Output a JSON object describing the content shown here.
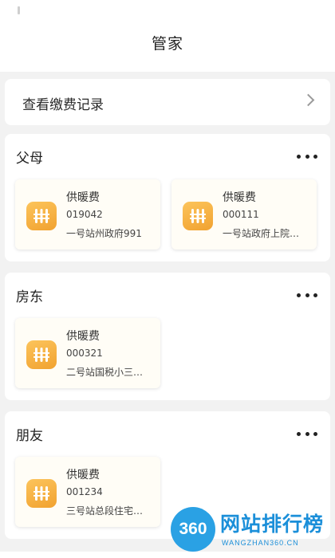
{
  "header": {
    "title": "管家"
  },
  "records": {
    "label": "查看缴费记录"
  },
  "groups": [
    {
      "title": "父母",
      "cards": [
        {
          "name": "供暖费",
          "code": "019042",
          "address": "一号站州政府991"
        },
        {
          "name": "供暖费",
          "code": "000111",
          "address": "一号站政府上院…"
        }
      ]
    },
    {
      "title": "房东",
      "cards": [
        {
          "name": "供暖费",
          "code": "000321",
          "address": "二号站国税小三…"
        }
      ]
    },
    {
      "title": "朋友",
      "cards": [
        {
          "name": "供暖费",
          "code": "001234",
          "address": "三号站总段住宅…"
        }
      ]
    }
  ],
  "watermark": {
    "logo": "360",
    "title": "网站排行榜",
    "subtitle": "WANGZHAN360.CN"
  },
  "icons": {
    "records": "chevron-right-icon",
    "group_menu": "more-horizontal-icon",
    "bill": "radiator-icon"
  },
  "colors": {
    "background": "#f2f2f2",
    "card": "#fffdf6",
    "icon_accent": "#f5ad3a",
    "watermark": "#1b8fd9"
  }
}
